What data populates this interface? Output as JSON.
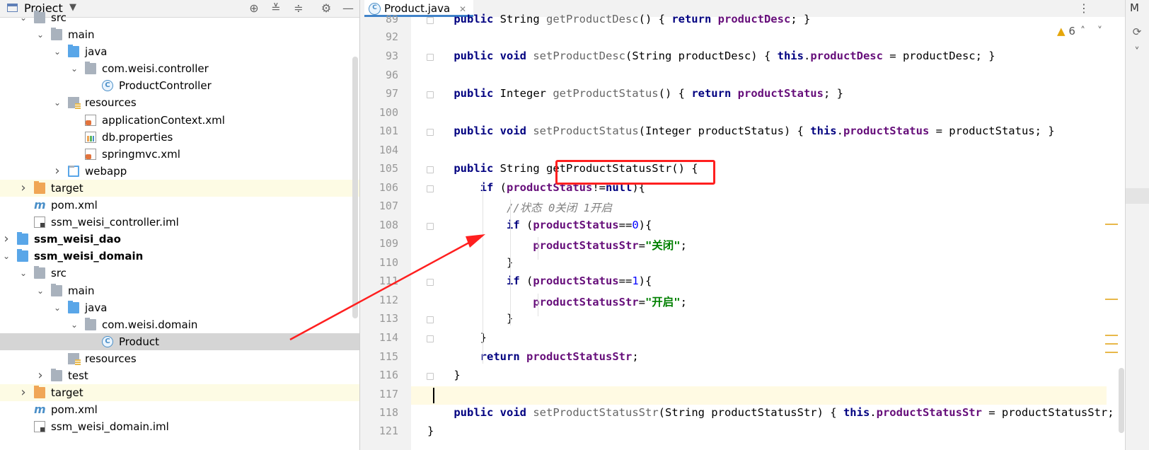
{
  "project_panel": {
    "title": "Project",
    "dropdown_glyph": "▼",
    "toolbar_icons": [
      "locate-icon",
      "expand-all-icon",
      "collapse-all-icon",
      "gear-icon",
      "minimize-icon"
    ],
    "tree": [
      {
        "label": "src",
        "icon": "folder-icon"
      },
      {
        "label": "main",
        "icon": "folder-icon"
      },
      {
        "label": "java",
        "icon": "source-folder-icon"
      },
      {
        "label": "com.weisi.controller",
        "icon": "package-icon"
      },
      {
        "label": "ProductController",
        "icon": "class-icon"
      },
      {
        "label": "resources",
        "icon": "resources-folder-icon"
      },
      {
        "label": "applicationContext.xml",
        "icon": "xml-file-icon"
      },
      {
        "label": "db.properties",
        "icon": "properties-file-icon"
      },
      {
        "label": "springmvc.xml",
        "icon": "xml-file-icon"
      },
      {
        "label": "webapp",
        "icon": "web-folder-icon"
      },
      {
        "label": "target",
        "icon": "excluded-folder-icon"
      },
      {
        "label": "pom.xml",
        "icon": "maven-icon"
      },
      {
        "label": "ssm_weisi_controller.iml",
        "icon": "iml-file-icon"
      },
      {
        "label": "ssm_weisi_dao",
        "icon": "module-folder-icon"
      },
      {
        "label": "ssm_weisi_domain",
        "icon": "module-folder-icon"
      },
      {
        "label": "src",
        "icon": "folder-icon"
      },
      {
        "label": "main",
        "icon": "folder-icon"
      },
      {
        "label": "java",
        "icon": "source-folder-icon"
      },
      {
        "label": "com.weisi.domain",
        "icon": "package-icon"
      },
      {
        "label": "Product",
        "icon": "class-icon"
      },
      {
        "label": "resources",
        "icon": "resources-folder-icon"
      },
      {
        "label": "test",
        "icon": "folder-icon"
      },
      {
        "label": "target",
        "icon": "excluded-folder-icon"
      },
      {
        "label": "pom.xml",
        "icon": "maven-icon"
      },
      {
        "label": "ssm_weisi_domain.iml",
        "icon": "iml-file-icon"
      }
    ]
  },
  "editor": {
    "tab": {
      "name": "Product.java",
      "close": "✕",
      "icon": "class-icon",
      "letter": "C"
    },
    "more_glyph": "⋮",
    "inspections": {
      "icon": "warning-icon",
      "glyph": "▲",
      "count": "6"
    },
    "nav_glyphs": [
      "˄",
      "˅"
    ],
    "right_strip": {
      "label": "M",
      "refresh": "⟳",
      "chevron": "˅"
    },
    "line_numbers": [
      "89",
      "92",
      "93",
      "96",
      "97",
      "100",
      "101",
      "104",
      "105",
      "106",
      "107",
      "108",
      "109",
      "110",
      "111",
      "112",
      "113",
      "114",
      "115",
      "116",
      "117",
      "118",
      "121"
    ],
    "code_lines": [
      "    public String getProductDesc() { return productDesc; }",
      "",
      "    public void setProductDesc(String productDesc) { this.productDesc = productDesc; }",
      "",
      "    public Integer getProductStatus() { return productStatus; }",
      "",
      "    public void setProductStatus(Integer productStatus) { this.productStatus = productStatus; }",
      "",
      "    public String getProductStatusStr() {",
      "        if (productStatus!=null){",
      "            //状态 0关闭 1开启",
      "            if (productStatus==0){",
      "                productStatusStr=\"关闭\";",
      "            }",
      "            if (productStatus==1){",
      "                productStatusStr=\"开启\";",
      "            }",
      "        }",
      "        return productStatusStr;",
      "    }",
      "",
      "    public void setProductStatusStr(String productStatusStr) { this.productStatusStr = productStatusStr; }",
      "}"
    ]
  },
  "colors": {
    "keyword": "#000080",
    "field": "#660e7a",
    "string": "#008000",
    "number": "#0000ff",
    "comment": "#808080",
    "annotation_red": "#ff1f1f",
    "selection": "#d5d5d5",
    "highlight_row": "#fdfbe4"
  }
}
